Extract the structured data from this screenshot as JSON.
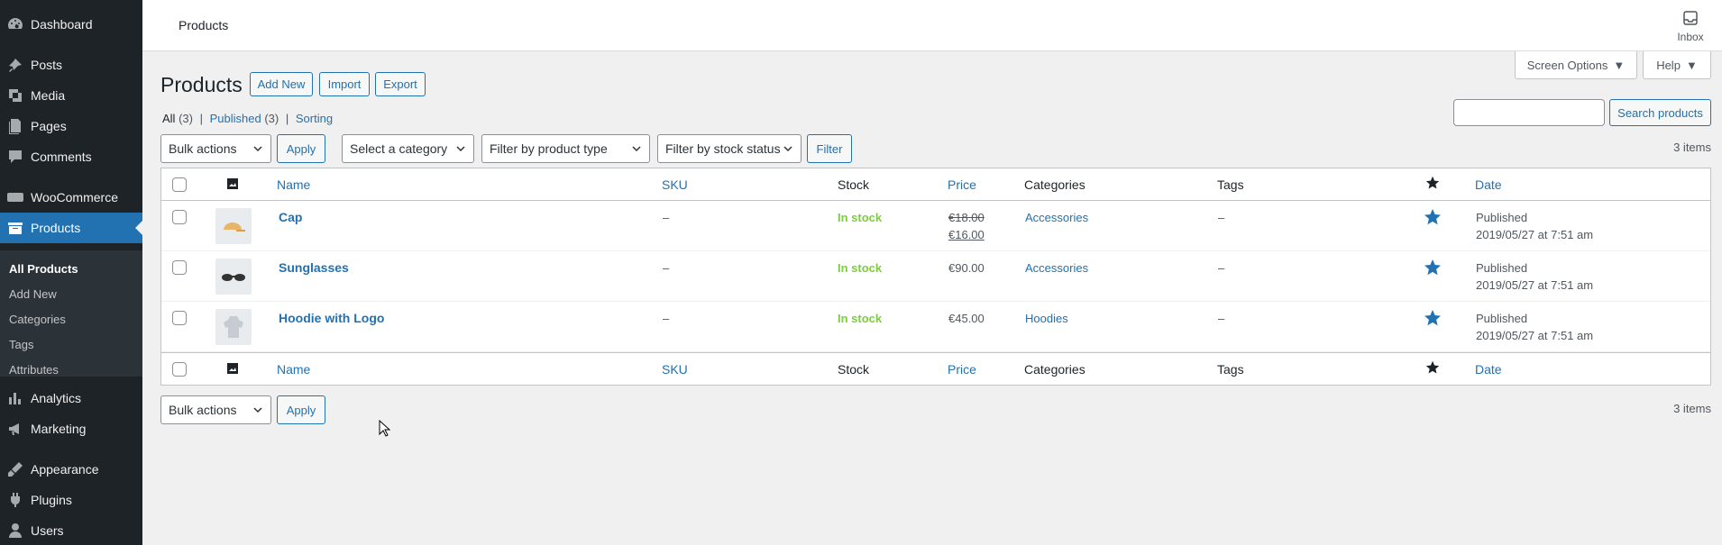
{
  "sidebar": {
    "items": [
      {
        "label": "Dashboard",
        "icon": "dashboard-icon"
      },
      {
        "label": "Posts",
        "icon": "posts-icon"
      },
      {
        "label": "Media",
        "icon": "media-icon"
      },
      {
        "label": "Pages",
        "icon": "pages-icon"
      },
      {
        "label": "Comments",
        "icon": "comments-icon"
      },
      {
        "label": "WooCommerce",
        "icon": "woocommerce-icon"
      },
      {
        "label": "Products",
        "icon": "products-icon"
      },
      {
        "label": "Analytics",
        "icon": "analytics-icon"
      },
      {
        "label": "Marketing",
        "icon": "marketing-icon"
      },
      {
        "label": "Appearance",
        "icon": "appearance-icon"
      },
      {
        "label": "Plugins",
        "icon": "plugins-icon"
      },
      {
        "label": "Users",
        "icon": "users-icon"
      }
    ],
    "submenu": [
      "All Products",
      "Add New",
      "Categories",
      "Tags",
      "Attributes"
    ]
  },
  "topbar": {
    "title": "Products",
    "inbox_label": "Inbox"
  },
  "screen_options_label": "Screen Options",
  "help_label": "Help",
  "page": {
    "title": "Products",
    "actions": {
      "add_new": "Add New",
      "import": "Import",
      "export": "Export"
    }
  },
  "views": {
    "all_label": "All",
    "all_count": "(3)",
    "published_label": "Published",
    "published_count": "(3)",
    "sorting_label": "Sorting",
    "sep": "|"
  },
  "search": {
    "placeholder": "",
    "button": "Search products"
  },
  "filters": {
    "bulk_actions": "Bulk actions",
    "apply": "Apply",
    "category": "Select a category",
    "product_type": "Filter by product type",
    "stock_status": "Filter by stock status",
    "filter_button": "Filter"
  },
  "items_count": "3 items",
  "table": {
    "columns": {
      "name": "Name",
      "sku": "SKU",
      "stock": "Stock",
      "price": "Price",
      "categories": "Categories",
      "tags": "Tags",
      "date": "Date"
    },
    "rows": [
      {
        "name": "Cap",
        "sku": "–",
        "stock": "In stock",
        "price_old": "€18.00",
        "price_new": "€16.00",
        "categories": "Accessories",
        "tags": "–",
        "date_status": "Published",
        "date": "2019/05/27 at 7:51 am",
        "thumb": "cap-thumbnail"
      },
      {
        "name": "Sunglasses",
        "sku": "–",
        "stock": "In stock",
        "price": "€90.00",
        "categories": "Accessories",
        "tags": "–",
        "date_status": "Published",
        "date": "2019/05/27 at 7:51 am",
        "thumb": "sunglasses-thumbnail"
      },
      {
        "name": "Hoodie with Logo",
        "sku": "–",
        "stock": "In stock",
        "price": "€45.00",
        "categories": "Hoodies",
        "tags": "–",
        "date_status": "Published",
        "date": "2019/05/27 at 7:51 am",
        "thumb": "hoodie-thumbnail"
      }
    ]
  },
  "colors": {
    "sidebar": "#1d2327",
    "accent": "#2271b1",
    "in_stock": "#7ad03a",
    "star": "#2271b1"
  }
}
